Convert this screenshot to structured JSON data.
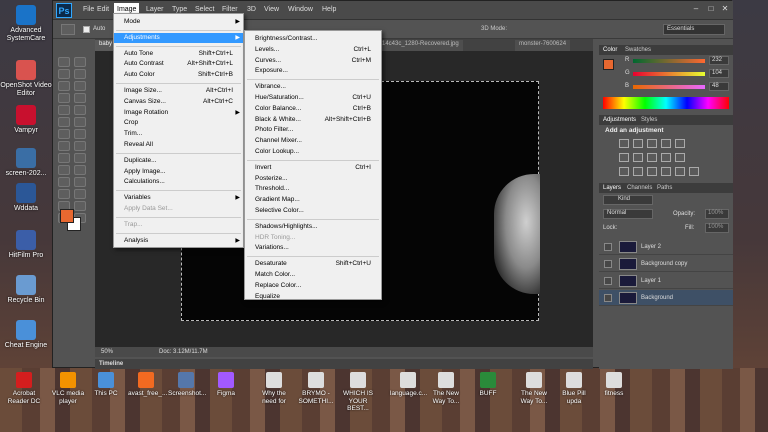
{
  "desktop": {
    "left_icons": [
      {
        "label": "Advanced SystemCare",
        "color": "#1a73c8"
      },
      {
        "label": "OpenShot Video Editor",
        "color": "#d9534f"
      },
      {
        "label": "Vampyr",
        "color": "#c8102e"
      },
      {
        "label": "screen-202...",
        "color": "#3a6ea5"
      },
      {
        "label": "Wddata",
        "color": "#2b5797"
      },
      {
        "label": "HitFilm Pro",
        "color": "#3b5ea8"
      },
      {
        "label": "Recycle Bin",
        "color": "#6a9bd1"
      },
      {
        "label": "Cheat Engine",
        "color": "#4a90d9"
      }
    ],
    "bottom_icons": [
      {
        "label": "Acrobat Reader DC",
        "color": "#d41e1e"
      },
      {
        "label": "VLC media player",
        "color": "#f39200"
      },
      {
        "label": "This PC",
        "color": "#4a90d9"
      },
      {
        "label": "avast_free_...",
        "color": "#f26a21"
      },
      {
        "label": "Screenshot...",
        "color": "#5577aa"
      },
      {
        "label": "Figma",
        "color": "#a259ff"
      },
      {
        "label": "Why the need for",
        "color": "#dddddd"
      },
      {
        "label": "BRYMO - SOMETHI...",
        "color": "#dddddd"
      },
      {
        "label": "WHICH IS YOUR BEST...",
        "color": "#dddddd"
      },
      {
        "label": "language.c...",
        "color": "#dddddd"
      },
      {
        "label": "The New Way To...",
        "color": "#dddddd"
      },
      {
        "label": "BUFF",
        "color": "#2a8a3a"
      },
      {
        "label": "The New Way To...",
        "color": "#dddddd"
      },
      {
        "label": "Blue Pill upda",
        "color": "#dddddd"
      },
      {
        "label": "fitness",
        "color": "#dddddd"
      }
    ]
  },
  "photoshop": {
    "logo": "Ps",
    "menus": [
      "File",
      "Edit",
      "Image",
      "Layer",
      "Type",
      "Select",
      "Filter",
      "3D",
      "View",
      "Window",
      "Help"
    ],
    "active_menu": "Image",
    "window_controls": [
      "–",
      "□",
      "✕"
    ],
    "options": {
      "auto_label": "Auto",
      "mode_label": "3D Mode:",
      "workspace": "Essentials"
    },
    "tabs": [
      "baby",
      "...14c43c_1280-Recovered.jpg",
      "monster-7600624"
    ],
    "status": {
      "zoom": "50%",
      "doc": "Doc: 3.12M/11.7M"
    },
    "timeline_label": "Timeline",
    "color_panel": {
      "tabs": [
        "Color",
        "Swatches"
      ],
      "r": "232",
      "g": "104",
      "b": "48",
      "fg_color": "#e86830",
      "bg_color": "#ffffff"
    },
    "adjustments_panel": {
      "tabs": [
        "Adjustments",
        "Styles"
      ],
      "heading": "Add an adjustment"
    },
    "layers_panel": {
      "tabs": [
        "Layers",
        "Channels",
        "Paths"
      ],
      "kind": "Kind",
      "blend": "Normal",
      "opacity_label": "Opacity:",
      "opacity_value": "100%",
      "lock_label": "Lock:",
      "fill_label": "Fill:",
      "fill_value": "100%",
      "layers": [
        {
          "name": "Layer 2",
          "selected": false
        },
        {
          "name": "Background copy",
          "selected": false
        },
        {
          "name": "Layer 1",
          "selected": false
        },
        {
          "name": "Background",
          "selected": true
        }
      ]
    }
  },
  "image_menu": {
    "items": [
      {
        "label": "Mode",
        "shortcut": "",
        "submenu": true
      },
      {
        "sep": true
      },
      {
        "label": "Adjustments",
        "shortcut": "",
        "submenu": true,
        "highlight": true
      },
      {
        "sep": true
      },
      {
        "label": "Auto Tone",
        "shortcut": "Shift+Ctrl+L"
      },
      {
        "label": "Auto Contrast",
        "shortcut": "Alt+Shift+Ctrl+L"
      },
      {
        "label": "Auto Color",
        "shortcut": "Shift+Ctrl+B"
      },
      {
        "sep": true
      },
      {
        "label": "Image Size...",
        "shortcut": "Alt+Ctrl+I"
      },
      {
        "label": "Canvas Size...",
        "shortcut": "Alt+Ctrl+C"
      },
      {
        "label": "Image Rotation",
        "shortcut": "",
        "submenu": true
      },
      {
        "label": "Crop",
        "shortcut": ""
      },
      {
        "label": "Trim...",
        "shortcut": ""
      },
      {
        "label": "Reveal All",
        "shortcut": ""
      },
      {
        "sep": true
      },
      {
        "label": "Duplicate...",
        "shortcut": ""
      },
      {
        "label": "Apply Image...",
        "shortcut": ""
      },
      {
        "label": "Calculations...",
        "shortcut": ""
      },
      {
        "sep": true
      },
      {
        "label": "Variables",
        "shortcut": "",
        "submenu": true
      },
      {
        "label": "Apply Data Set...",
        "shortcut": "",
        "disabled": true
      },
      {
        "sep": true
      },
      {
        "label": "Trap...",
        "shortcut": "",
        "disabled": true
      },
      {
        "sep": true
      },
      {
        "label": "Analysis",
        "shortcut": "",
        "submenu": true
      }
    ]
  },
  "adjustments_menu": {
    "items": [
      {
        "label": "Brightness/Contrast...",
        "shortcut": ""
      },
      {
        "label": "Levels...",
        "shortcut": "Ctrl+L"
      },
      {
        "label": "Curves...",
        "shortcut": "Ctrl+M"
      },
      {
        "label": "Exposure...",
        "shortcut": ""
      },
      {
        "sep": true
      },
      {
        "label": "Vibrance...",
        "shortcut": ""
      },
      {
        "label": "Hue/Saturation...",
        "shortcut": "Ctrl+U"
      },
      {
        "label": "Color Balance...",
        "shortcut": "Ctrl+B"
      },
      {
        "label": "Black & White...",
        "shortcut": "Alt+Shift+Ctrl+B"
      },
      {
        "label": "Photo Filter...",
        "shortcut": ""
      },
      {
        "label": "Channel Mixer...",
        "shortcut": ""
      },
      {
        "label": "Color Lookup...",
        "shortcut": ""
      },
      {
        "sep": true
      },
      {
        "label": "Invert",
        "shortcut": "Ctrl+I"
      },
      {
        "label": "Posterize...",
        "shortcut": ""
      },
      {
        "label": "Threshold...",
        "shortcut": ""
      },
      {
        "label": "Gradient Map...",
        "shortcut": ""
      },
      {
        "label": "Selective Color...",
        "shortcut": ""
      },
      {
        "sep": true
      },
      {
        "label": "Shadows/Highlights...",
        "shortcut": ""
      },
      {
        "label": "HDR Toning...",
        "shortcut": "",
        "disabled": true
      },
      {
        "label": "Variations...",
        "shortcut": ""
      },
      {
        "sep": true
      },
      {
        "label": "Desaturate",
        "shortcut": "Shift+Ctrl+U"
      },
      {
        "label": "Match Color...",
        "shortcut": ""
      },
      {
        "label": "Replace Color...",
        "shortcut": ""
      },
      {
        "label": "Equalize",
        "shortcut": ""
      }
    ]
  }
}
